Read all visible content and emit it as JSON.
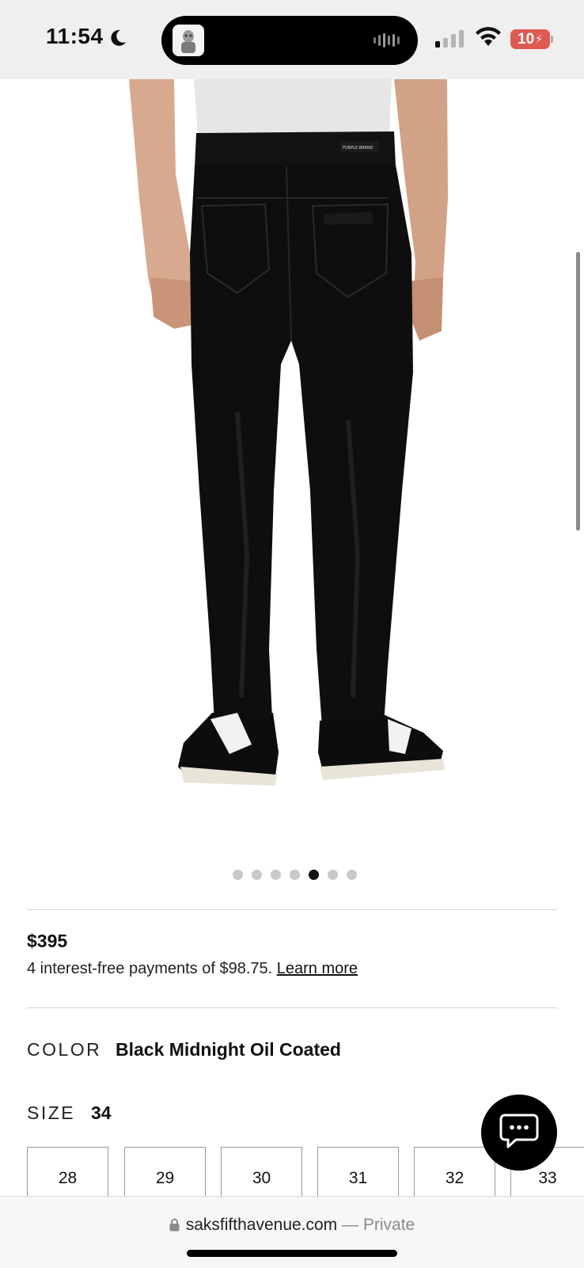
{
  "status_bar": {
    "time": "11:54",
    "battery": "10",
    "icons": [
      "moon-icon",
      "waveform-icon",
      "signal-icon",
      "wifi-icon",
      "battery-charging-icon"
    ]
  },
  "carousel": {
    "count": 7,
    "active_index": 4
  },
  "product": {
    "price": "$395",
    "installments_text": "4 interest-free payments of $98.75.",
    "learn_more": "Learn more",
    "color_label": "COLOR",
    "color_value": "Black Midnight Oil Coated",
    "size_label": "SIZE",
    "size_value": "34",
    "sizes": [
      "28",
      "29",
      "30",
      "31",
      "32",
      "33"
    ]
  },
  "browser": {
    "domain": "saksfifthavenue.com",
    "separator": "—",
    "mode": "Private"
  },
  "colors": {
    "accent": "#000000",
    "status_bg": "#efefef",
    "battery": "#e05a52",
    "divider": "#d3d3d3"
  }
}
